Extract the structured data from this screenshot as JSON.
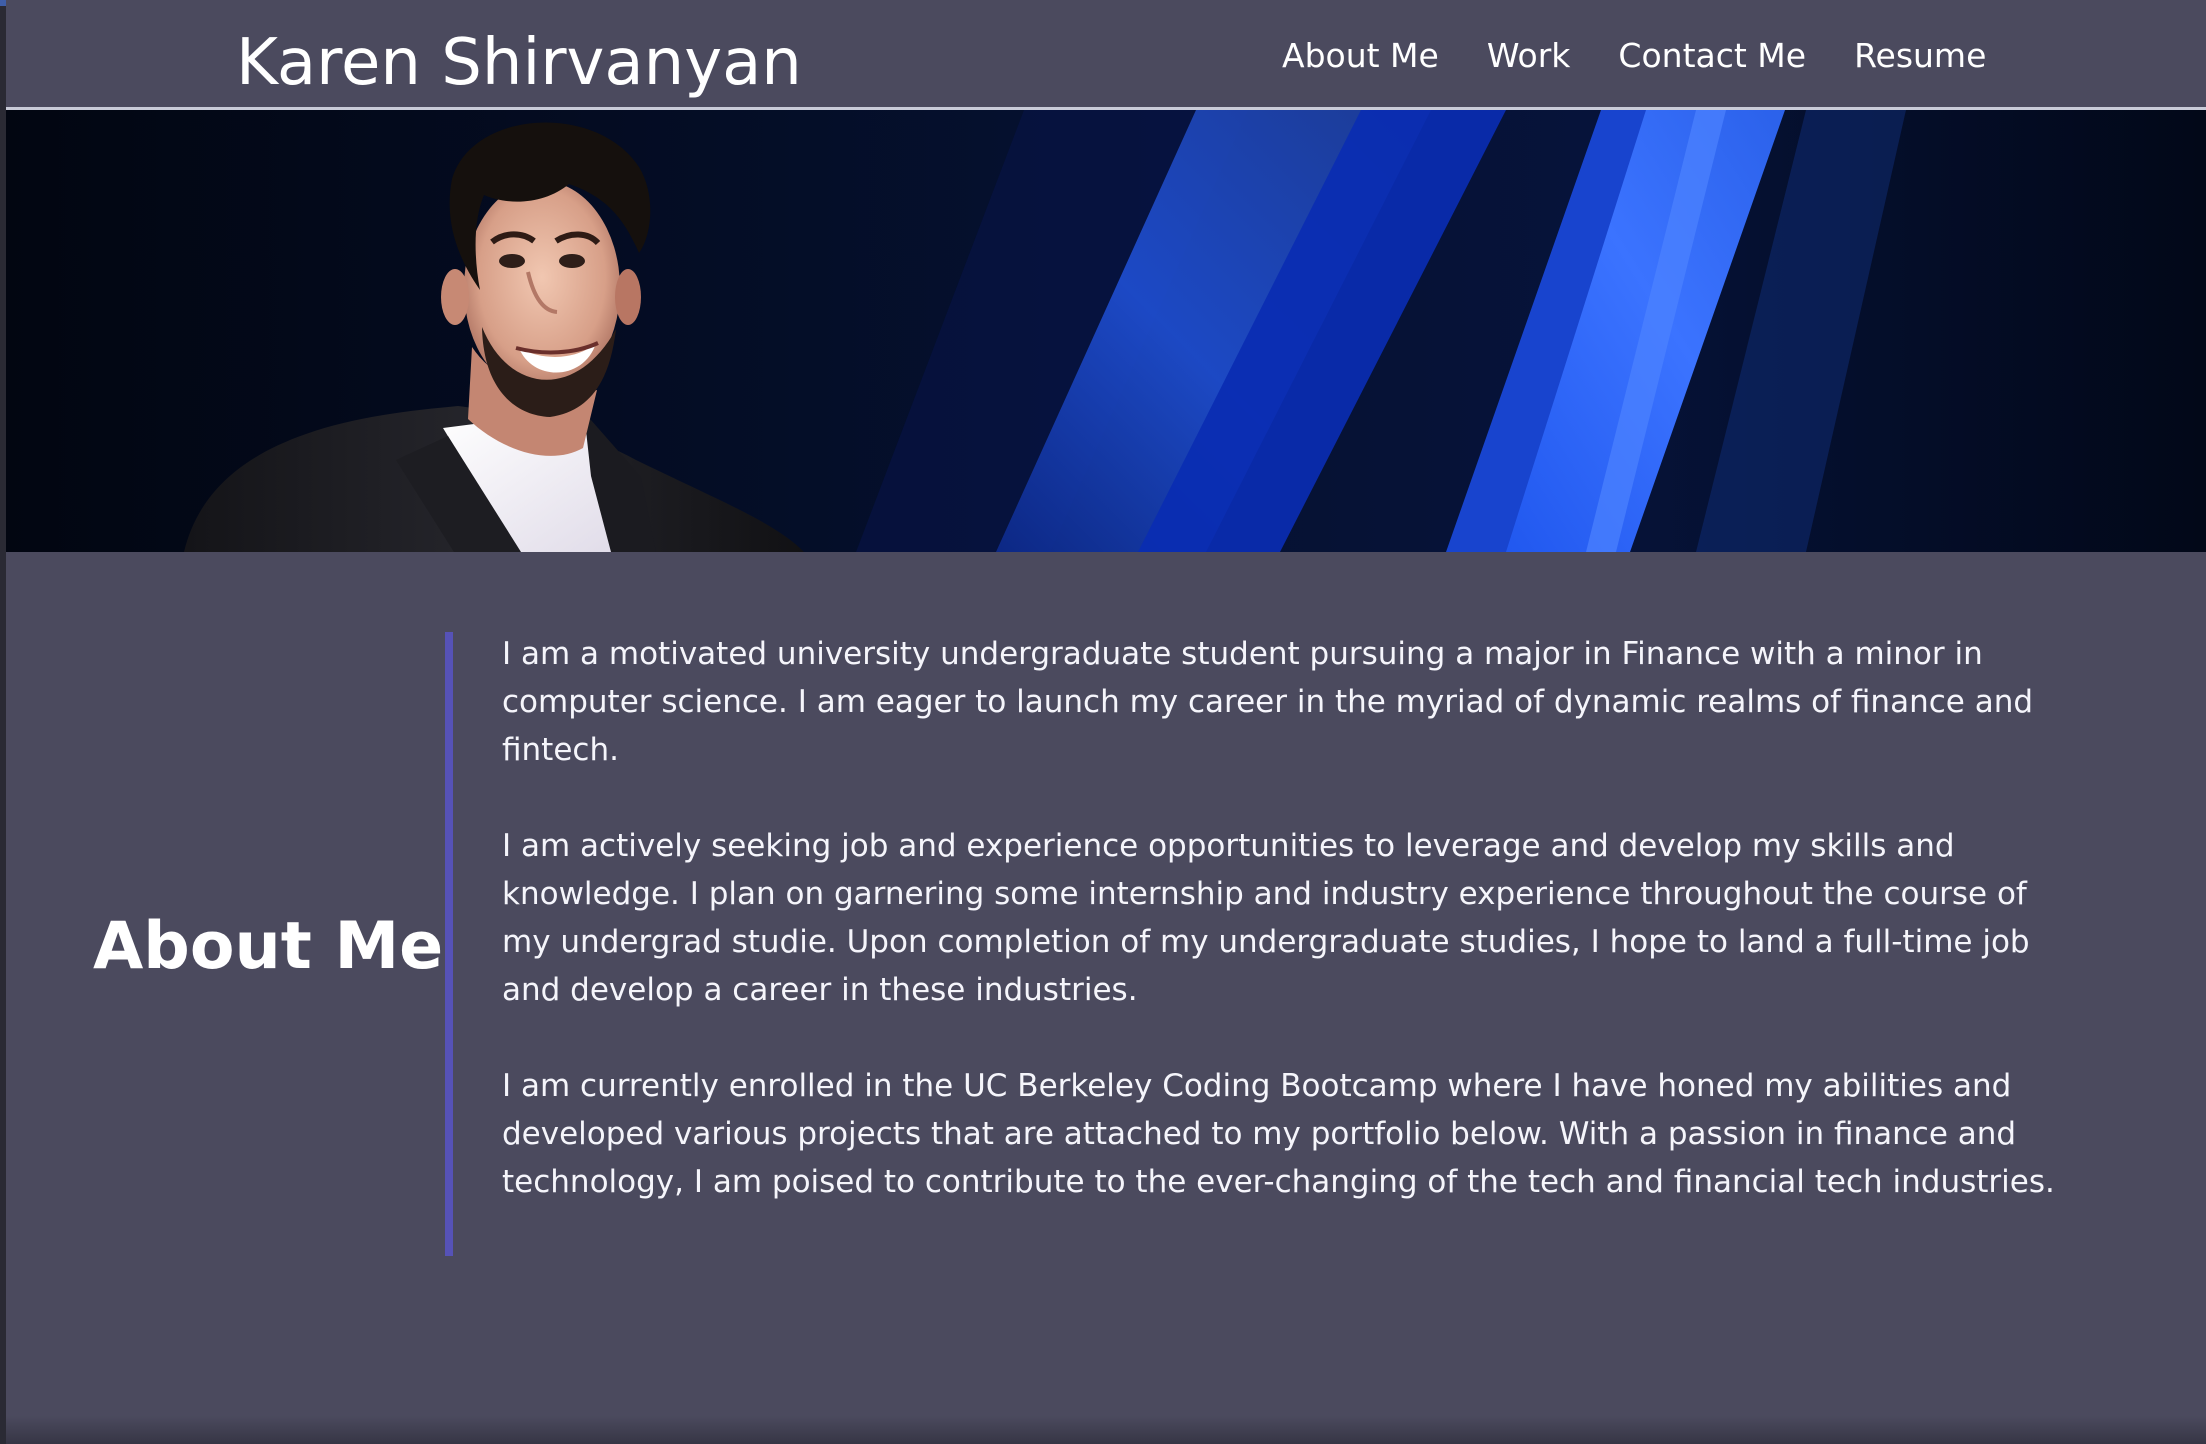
{
  "header": {
    "site_name": "Karen Shirvanyan",
    "nav": [
      "About Me",
      "Work",
      "Contact Me",
      "Resume"
    ]
  },
  "hero": {
    "image": "portrait-photo",
    "background": "blue-light-streak"
  },
  "about": {
    "title": "About Me",
    "paragraphs": [
      "I am a motivated university undergraduate student pursuing a major in Finance with a minor in computer science. I am eager to launch my career in the myriad of dynamic realms of finance and fintech.",
      "I am actively seeking job and experience opportunities to leverage and develop my skills and knowledge. I plan on garnering some internship and industry experience throughout the course of my undergrad studie. Upon completion of my undergraduate studies, I hope to land a full-time job and develop a career in these industries.",
      "I am currently enrolled in the UC Berkeley Coding Bootcamp where I have honed my abilities and developed various projects that are attached to my portfolio below. With a passion in finance and technology, I am poised to contribute to the ever-changing of the tech and financial tech industries."
    ]
  },
  "colors": {
    "page_background": "#4b4a5e",
    "header_border": "#c9cbd8",
    "divider": "#5652b7",
    "hero_background": "#050814",
    "accent_blue": "#3f6cf4"
  }
}
